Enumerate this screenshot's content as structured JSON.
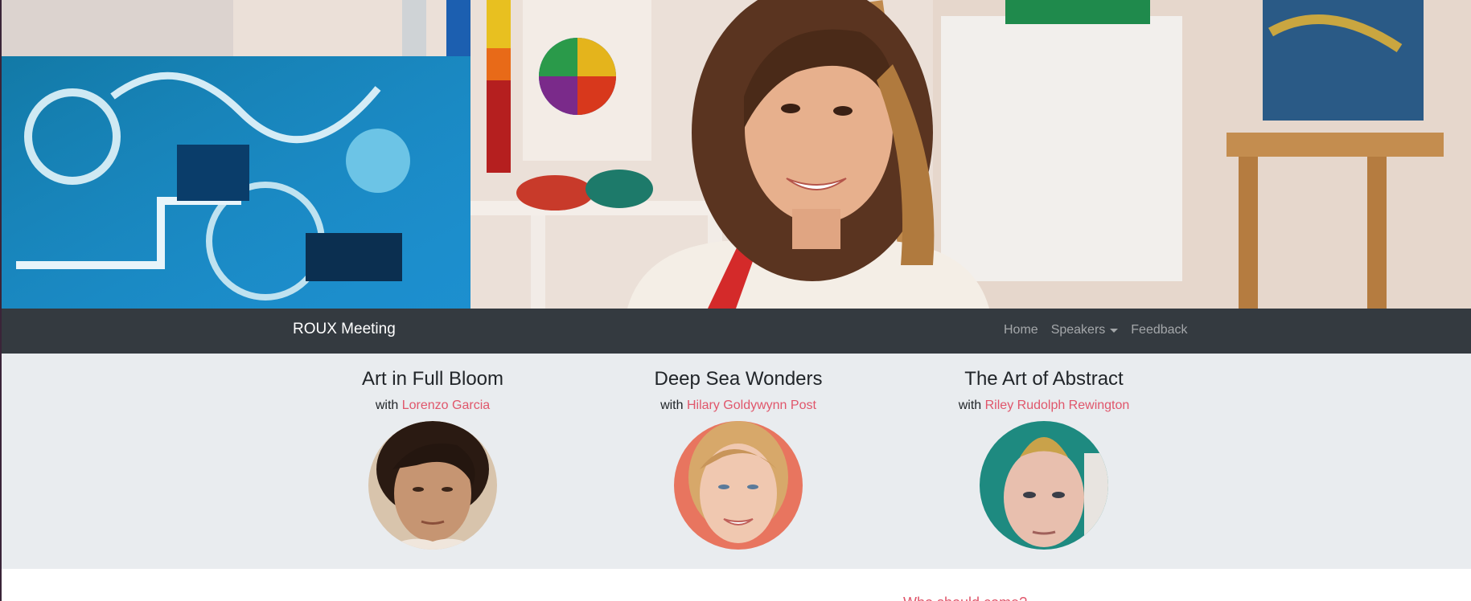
{
  "hero": {
    "image": "hero-photo-artist-in-studio"
  },
  "navbar": {
    "brand": "ROUX Meeting",
    "links": [
      {
        "label": "Home"
      },
      {
        "label": "Speakers",
        "icon": "caret-down-icon"
      },
      {
        "label": "Feedback"
      }
    ]
  },
  "sessions": [
    {
      "title": "Art in Full Bloom",
      "with_prefix": "with",
      "speaker": "Lorenzo Garcia",
      "avatar": "speaker-photo-lorenzo-garcia"
    },
    {
      "title": "Deep Sea Wonders",
      "with_prefix": "with",
      "speaker": "Hilary Goldywynn Post",
      "avatar": "speaker-photo-hilary-goldywynn-post"
    },
    {
      "title": "The Art of Abstract",
      "with_prefix": "with",
      "speaker": "Riley Rudolph Rewington",
      "avatar": "speaker-photo-riley-rudolph-rewington"
    }
  ],
  "bottom": {
    "link": "Who should come?"
  },
  "colors": {
    "navbar": "#343a40",
    "sessions_bg": "#e9ecef",
    "accent": "#e0566b"
  }
}
